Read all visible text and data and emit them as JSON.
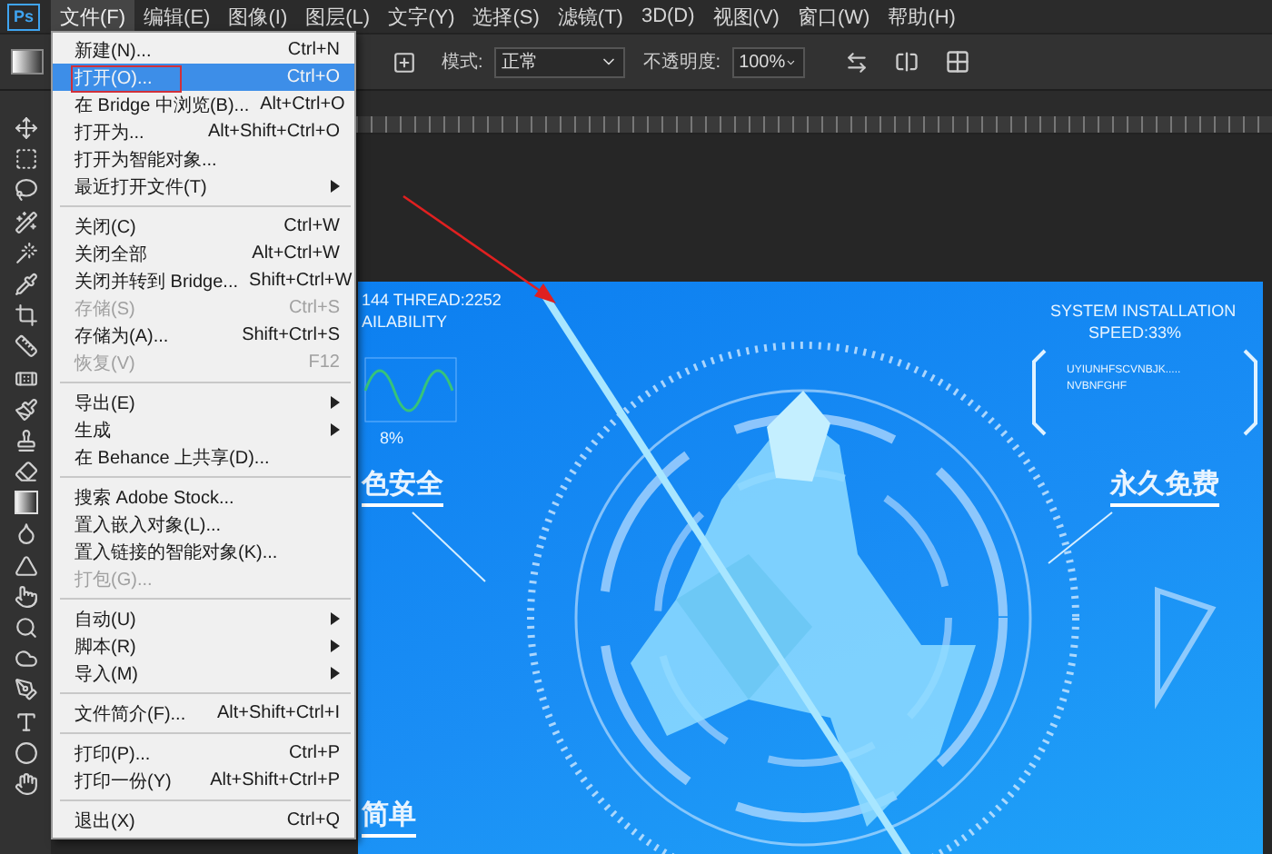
{
  "app": {
    "logo": "Ps"
  },
  "menu_bar": [
    {
      "label": "文件(F)",
      "selected": true
    },
    {
      "label": "编辑(E)",
      "selected": false
    },
    {
      "label": "图像(I)",
      "selected": false
    },
    {
      "label": "图层(L)",
      "selected": false
    },
    {
      "label": "文字(Y)",
      "selected": false
    },
    {
      "label": "选择(S)",
      "selected": false
    },
    {
      "label": "滤镜(T)",
      "selected": false
    },
    {
      "label": "3D(D)",
      "selected": false
    },
    {
      "label": "视图(V)",
      "selected": false
    },
    {
      "label": "窗口(W)",
      "selected": false
    },
    {
      "label": "帮助(H)",
      "selected": false
    }
  ],
  "options_bar": {
    "mode_label": "模式:",
    "mode_value": "正常",
    "opacity_label": "不透明度:",
    "opacity_value": "100%"
  },
  "file_menu": {
    "groups": [
      {
        "items": [
          {
            "label": "新建(N)...",
            "shortcut": "Ctrl+N",
            "selected": false,
            "disabled": false,
            "submenu": false,
            "outlined": false
          },
          {
            "label": "打开(O)...",
            "shortcut": "Ctrl+O",
            "selected": true,
            "disabled": false,
            "submenu": false,
            "outlined": true
          },
          {
            "label": "在 Bridge 中浏览(B)...",
            "shortcut": "Alt+Ctrl+O",
            "selected": false,
            "disabled": false,
            "submenu": false,
            "outlined": false
          },
          {
            "label": "打开为...",
            "shortcut": "Alt+Shift+Ctrl+O",
            "selected": false,
            "disabled": false,
            "submenu": false,
            "outlined": false
          },
          {
            "label": "打开为智能对象...",
            "selected": false,
            "disabled": false,
            "submenu": false,
            "outlined": false
          },
          {
            "label": "最近打开文件(T)",
            "selected": false,
            "disabled": false,
            "submenu": true,
            "outlined": false
          }
        ]
      },
      {
        "items": [
          {
            "label": "关闭(C)",
            "shortcut": "Ctrl+W",
            "selected": false,
            "disabled": false,
            "submenu": false,
            "outlined": false
          },
          {
            "label": "关闭全部",
            "shortcut": "Alt+Ctrl+W",
            "selected": false,
            "disabled": false,
            "submenu": false,
            "outlined": false
          },
          {
            "label": "关闭并转到 Bridge...",
            "shortcut": "Shift+Ctrl+W",
            "selected": false,
            "disabled": false,
            "submenu": false,
            "outlined": false
          },
          {
            "label": "存储(S)",
            "shortcut": "Ctrl+S",
            "selected": false,
            "disabled": true,
            "submenu": false,
            "outlined": false
          },
          {
            "label": "存储为(A)...",
            "shortcut": "Shift+Ctrl+S",
            "selected": false,
            "disabled": false,
            "submenu": false,
            "outlined": false
          },
          {
            "label": "恢复(V)",
            "shortcut": "F12",
            "selected": false,
            "disabled": true,
            "submenu": false,
            "outlined": false
          }
        ]
      },
      {
        "items": [
          {
            "label": "导出(E)",
            "selected": false,
            "disabled": false,
            "submenu": true,
            "outlined": false
          },
          {
            "label": "生成",
            "selected": false,
            "disabled": false,
            "submenu": true,
            "outlined": false
          },
          {
            "label": "在 Behance 上共享(D)...",
            "selected": false,
            "disabled": false,
            "submenu": false,
            "outlined": false
          }
        ]
      },
      {
        "items": [
          {
            "label": "搜索 Adobe Stock...",
            "selected": false,
            "disabled": false,
            "submenu": false,
            "outlined": false
          },
          {
            "label": "置入嵌入对象(L)...",
            "selected": false,
            "disabled": false,
            "submenu": false,
            "outlined": false
          },
          {
            "label": "置入链接的智能对象(K)...",
            "selected": false,
            "disabled": false,
            "submenu": false,
            "outlined": false
          },
          {
            "label": "打包(G)...",
            "selected": false,
            "disabled": true,
            "submenu": false,
            "outlined": false
          }
        ]
      },
      {
        "items": [
          {
            "label": "自动(U)",
            "selected": false,
            "disabled": false,
            "submenu": true,
            "outlined": false
          },
          {
            "label": "脚本(R)",
            "selected": false,
            "disabled": false,
            "submenu": true,
            "outlined": false
          },
          {
            "label": "导入(M)",
            "selected": false,
            "disabled": false,
            "submenu": true,
            "outlined": false
          }
        ]
      },
      {
        "items": [
          {
            "label": "文件简介(F)...",
            "shortcut": "Alt+Shift+Ctrl+I",
            "selected": false,
            "disabled": false,
            "submenu": false,
            "outlined": false
          }
        ]
      },
      {
        "items": [
          {
            "label": "打印(P)...",
            "shortcut": "Ctrl+P",
            "selected": false,
            "disabled": false,
            "submenu": false,
            "outlined": false
          },
          {
            "label": "打印一份(Y)",
            "shortcut": "Alt+Shift+Ctrl+P",
            "selected": false,
            "disabled": false,
            "submenu": false,
            "outlined": false
          }
        ]
      },
      {
        "items": [
          {
            "label": "退出(X)",
            "shortcut": "Ctrl+Q",
            "selected": false,
            "disabled": false,
            "submenu": false,
            "outlined": false
          }
        ]
      }
    ]
  },
  "canvas": {
    "left_panel": {
      "line_1": "144  THREAD:2252",
      "line_2": "AILABILITY",
      "percent": "8%"
    },
    "left_heading": "色安全",
    "right_panel": {
      "title": "SYSTEM INSTALLATION",
      "speed": "SPEED:33%",
      "line_1": "UYIUNHFSCVNBJK.....",
      "line_2": "NVBNFGHF"
    },
    "right_heading": "永久免费",
    "bottom_heading": "简单"
  }
}
